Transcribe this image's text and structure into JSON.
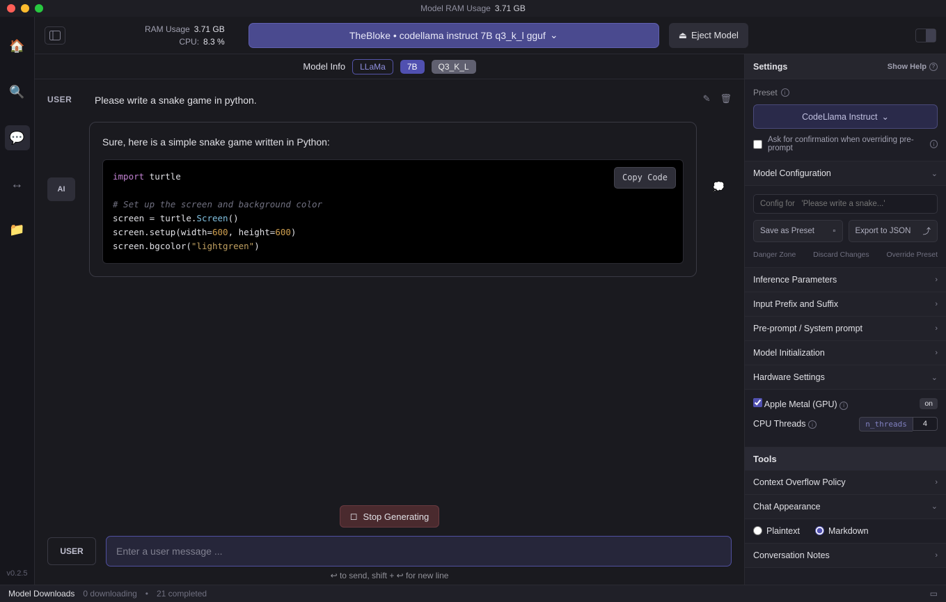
{
  "titlebar": {
    "label": "Model RAM Usage",
    "value": "3.71 GB"
  },
  "sidebar": {
    "items": [
      "🏠",
      "🔍",
      "💬",
      "↔",
      "📁"
    ],
    "version": "v0.2.5"
  },
  "topbar": {
    "ram_label": "RAM Usage",
    "ram_value": "3.71 GB",
    "cpu_label": "CPU:",
    "cpu_value": "8.3 %",
    "model_pill": "TheBloke • codellama instruct 7B q3_k_l gguf",
    "eject_label": "Eject Model"
  },
  "modelinfo": {
    "label": "Model Info",
    "badges": {
      "arch": "LLaMa",
      "size": "7B",
      "quant": "Q3_K_L"
    }
  },
  "chat": {
    "user_role": "USER",
    "user_msg": "Please write a snake game in python.",
    "ai_role": "AI",
    "ai_intro": "Sure, here is a simple snake game written in Python:",
    "copy_label": "Copy Code",
    "code": {
      "l1_kw": "import",
      "l1_rest": " turtle",
      "l2": "# Set up the screen and background color",
      "l3a": "screen = turtle.",
      "l3b": "Screen",
      "l3c": "()",
      "l4a": "screen.setup(width=",
      "l4b": "600",
      "l4c": ", height=",
      "l4d": "600",
      "l4e": ")",
      "l5a": "screen.bgcolor(",
      "l5b": "\"lightgreen\"",
      "l5c": ")"
    },
    "stop_label": "Stop Generating",
    "input_role": "USER",
    "input_placeholder": "Enter a user message ...",
    "hint": "↩ to send, shift + ↩ for new line"
  },
  "settings": {
    "header": "Settings",
    "show_help": "Show Help",
    "preset_label": "Preset",
    "preset_value": "CodeLlama Instruct",
    "confirm_label": "Ask for confirmation when overriding pre-prompt",
    "model_config": "Model Configuration",
    "config_placeholder": "Config for   'Please write a snake...'",
    "save_preset": "Save as Preset",
    "export_json": "Export to JSON",
    "danger": "Danger Zone",
    "discard": "Discard Changes",
    "override": "Override Preset",
    "sections": {
      "inference": "Inference Parameters",
      "prefix": "Input Prefix and Suffix",
      "preprompt": "Pre-prompt / System prompt",
      "init": "Model Initialization",
      "hardware": "Hardware Settings"
    },
    "hw": {
      "metal_label": "Apple Metal (GPU)",
      "metal_state": "on",
      "threads_label": "CPU Threads",
      "threads_key": "n_threads",
      "threads_val": "4"
    },
    "tools": "Tools",
    "overflow": "Context Overflow Policy",
    "appearance": "Chat Appearance",
    "plaintext": "Plaintext",
    "markdown": "Markdown",
    "notes": "Conversation Notes"
  },
  "bottombar": {
    "label": "Model Downloads",
    "downloading": "0 downloading",
    "completed": "21 completed"
  }
}
